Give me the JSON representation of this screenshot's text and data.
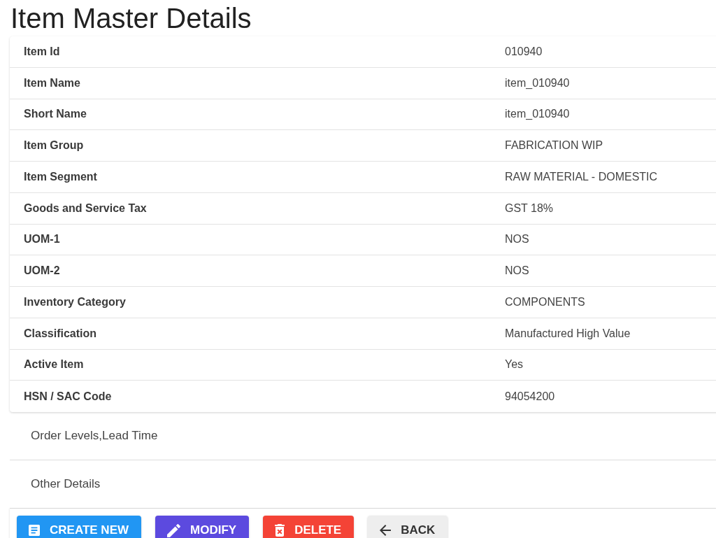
{
  "page": {
    "title": "Item Master Details"
  },
  "details": [
    {
      "label": "Item Id",
      "value": "010940"
    },
    {
      "label": "Item Name",
      "value": "item_010940"
    },
    {
      "label": "Short Name",
      "value": "item_010940"
    },
    {
      "label": "Item Group",
      "value": "FABRICATION WIP"
    },
    {
      "label": "Item Segment",
      "value": "RAW MATERIAL - DOMESTIC"
    },
    {
      "label": "Goods and Service Tax",
      "value": "GST 18%"
    },
    {
      "label": "UOM-1",
      "value": "NOS"
    },
    {
      "label": "UOM-2",
      "value": "NOS"
    },
    {
      "label": "Inventory Category",
      "value": "COMPONENTS"
    },
    {
      "label": "Classification",
      "value": "Manufactured High Value"
    },
    {
      "label": "Active Item",
      "value": "Yes"
    },
    {
      "label": "HSN / SAC Code",
      "value": "94054200"
    }
  ],
  "sections": [
    {
      "title": "Order Levels,Lead Time"
    },
    {
      "title": "Other Details"
    }
  ],
  "actions": [
    {
      "kind": "create",
      "label": "CREATE NEW"
    },
    {
      "kind": "modify",
      "label": "MODIFY"
    },
    {
      "kind": "delete",
      "label": "DELETE"
    },
    {
      "kind": "back",
      "label": "BACK"
    }
  ]
}
